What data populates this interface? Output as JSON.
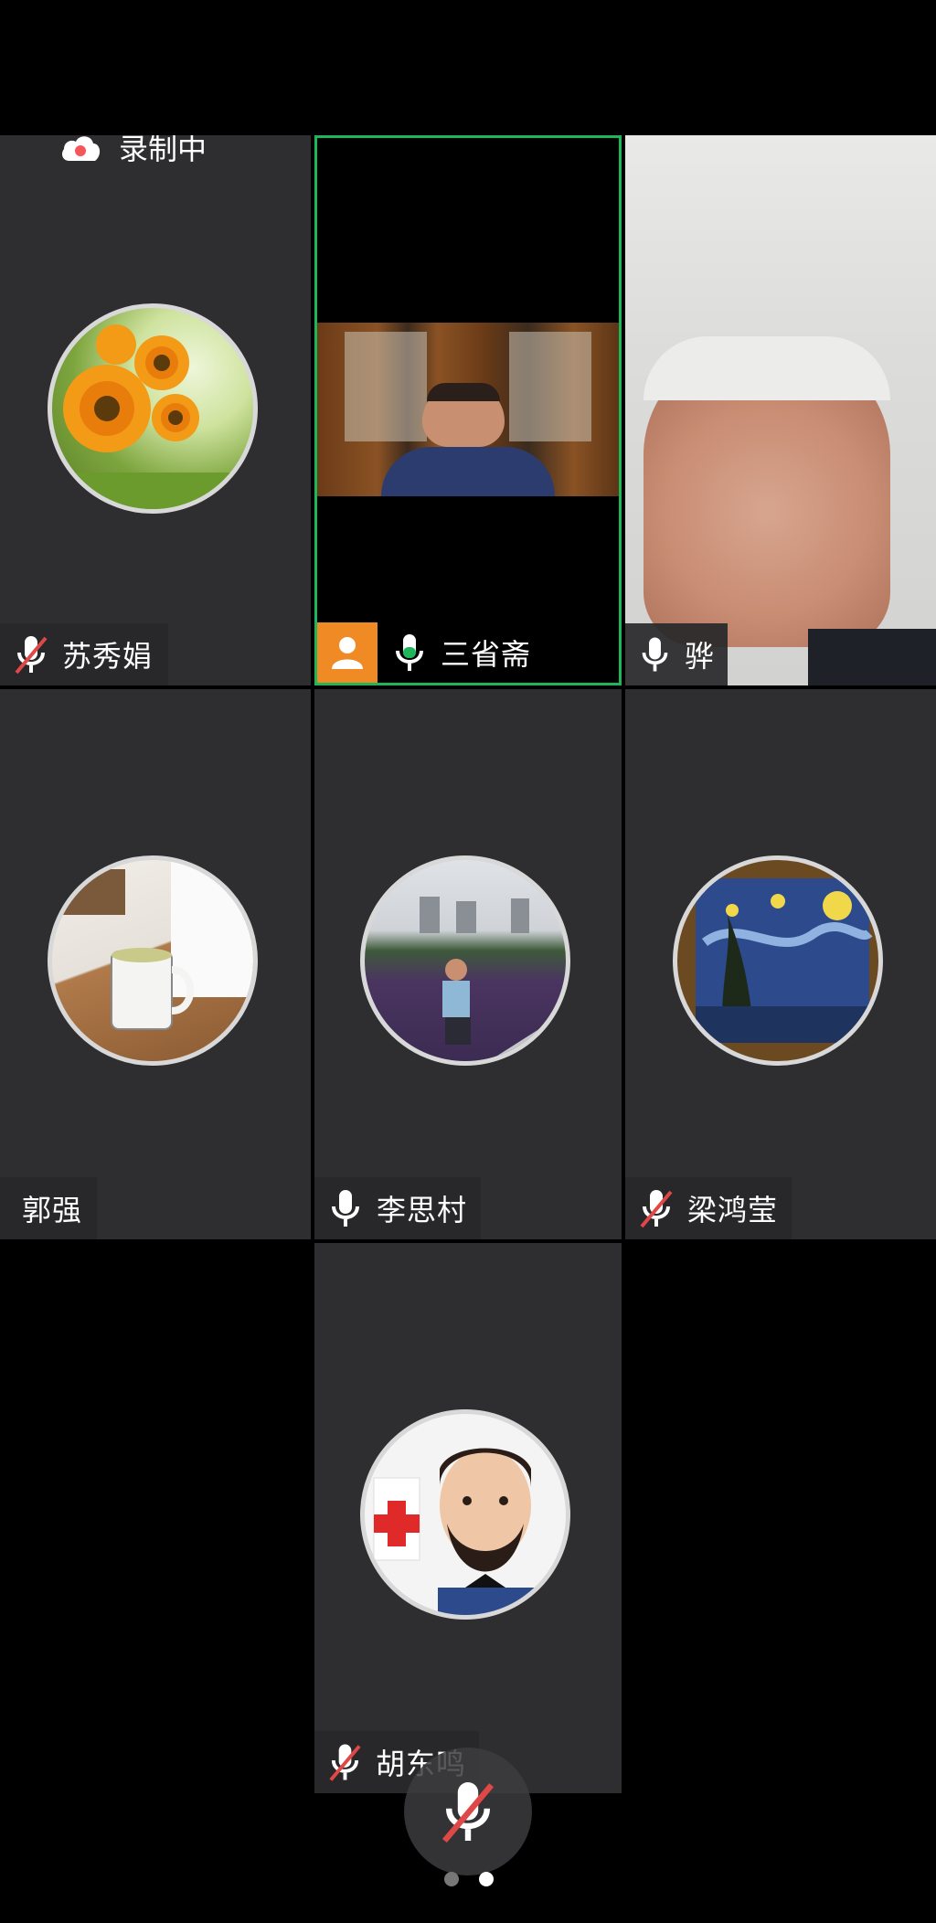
{
  "recording": {
    "label": "录制中",
    "icon": "cloud-record-icon"
  },
  "participants": [
    {
      "name": "苏秀娟",
      "mic": "muted",
      "avatar": "sunflower"
    },
    {
      "name": "三省斋",
      "mic": "active",
      "video": "on",
      "host_badge": "person-icon"
    },
    {
      "name": "骅",
      "mic": "unmuted",
      "video": "on"
    },
    {
      "name": "郭强",
      "mic": "none",
      "avatar": "tea-cup"
    },
    {
      "name": "李思村",
      "mic": "unmuted",
      "avatar": "man-outdoors"
    },
    {
      "name": "梁鸿莹",
      "mic": "muted",
      "avatar": "starry-night"
    },
    {
      "name": "胡东鸣",
      "mic": "muted",
      "avatar": "cartoon-doctor"
    }
  ],
  "controls": {
    "mute_button_icon": "mic-muted-icon"
  },
  "pagination": {
    "pages": 2,
    "current": 2
  },
  "colors": {
    "active_speaker": "#1fb65a",
    "host_badge": "#f08a24",
    "muted": "#e04848"
  }
}
